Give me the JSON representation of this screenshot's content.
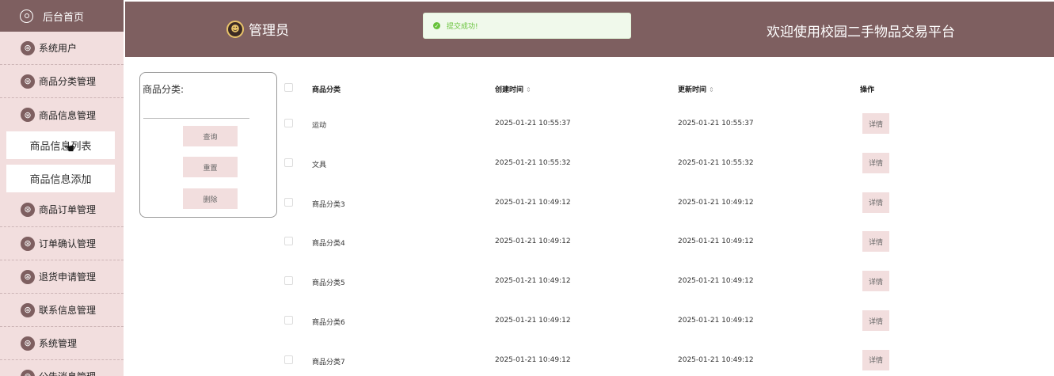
{
  "sidebar": {
    "home_label": "后台首页",
    "menu_icon_glyph": "⊛",
    "items": [
      {
        "label": "系统用户"
      },
      {
        "label": "商品分类管理"
      },
      {
        "label": "商品信息管理"
      },
      {
        "label": "商品订单管理"
      },
      {
        "label": "订单确认管理"
      },
      {
        "label": "退货申请管理"
      },
      {
        "label": "联系信息管理"
      },
      {
        "label": "系统管理"
      },
      {
        "label": "公告消息管理"
      }
    ],
    "sub_items": [
      {
        "label": "商品信息列表"
      },
      {
        "label": "商品信息添加"
      }
    ]
  },
  "header": {
    "admin_label": "管理员",
    "toast_text": "提交成功!",
    "welcome": "欢迎使用校园二手物品交易平台"
  },
  "search": {
    "label": "商品分类:",
    "value": "",
    "query_label": "查询",
    "reset_label": "重置",
    "delete_label": "删除"
  },
  "table": {
    "columns": [
      "商品分类",
      "创建时间",
      "更新时间",
      "操作"
    ],
    "sort_glyph": "⇕",
    "detail_label": "详情",
    "rows": [
      {
        "category": "运动",
        "created": "2025-01-21 10:55:37",
        "updated": "2025-01-21 10:55:37"
      },
      {
        "category": "文具",
        "created": "2025-01-21 10:55:32",
        "updated": "2025-01-21 10:55:32"
      },
      {
        "category": "商品分类3",
        "created": "2025-01-21 10:49:12",
        "updated": "2025-01-21 10:49:12"
      },
      {
        "category": "商品分类4",
        "created": "2025-01-21 10:49:12",
        "updated": "2025-01-21 10:49:12"
      },
      {
        "category": "商品分类5",
        "created": "2025-01-21 10:49:12",
        "updated": "2025-01-21 10:49:12"
      },
      {
        "category": "商品分类6",
        "created": "2025-01-21 10:49:12",
        "updated": "2025-01-21 10:49:12"
      },
      {
        "category": "商品分类7",
        "created": "2025-01-21 10:49:12",
        "updated": "2025-01-21 10:49:12"
      }
    ]
  },
  "colors": {
    "brand": "#7e5f60",
    "sidebar_bg": "#f2dede",
    "button_bg": "#f2dede",
    "toast_green": "#67c23a"
  }
}
